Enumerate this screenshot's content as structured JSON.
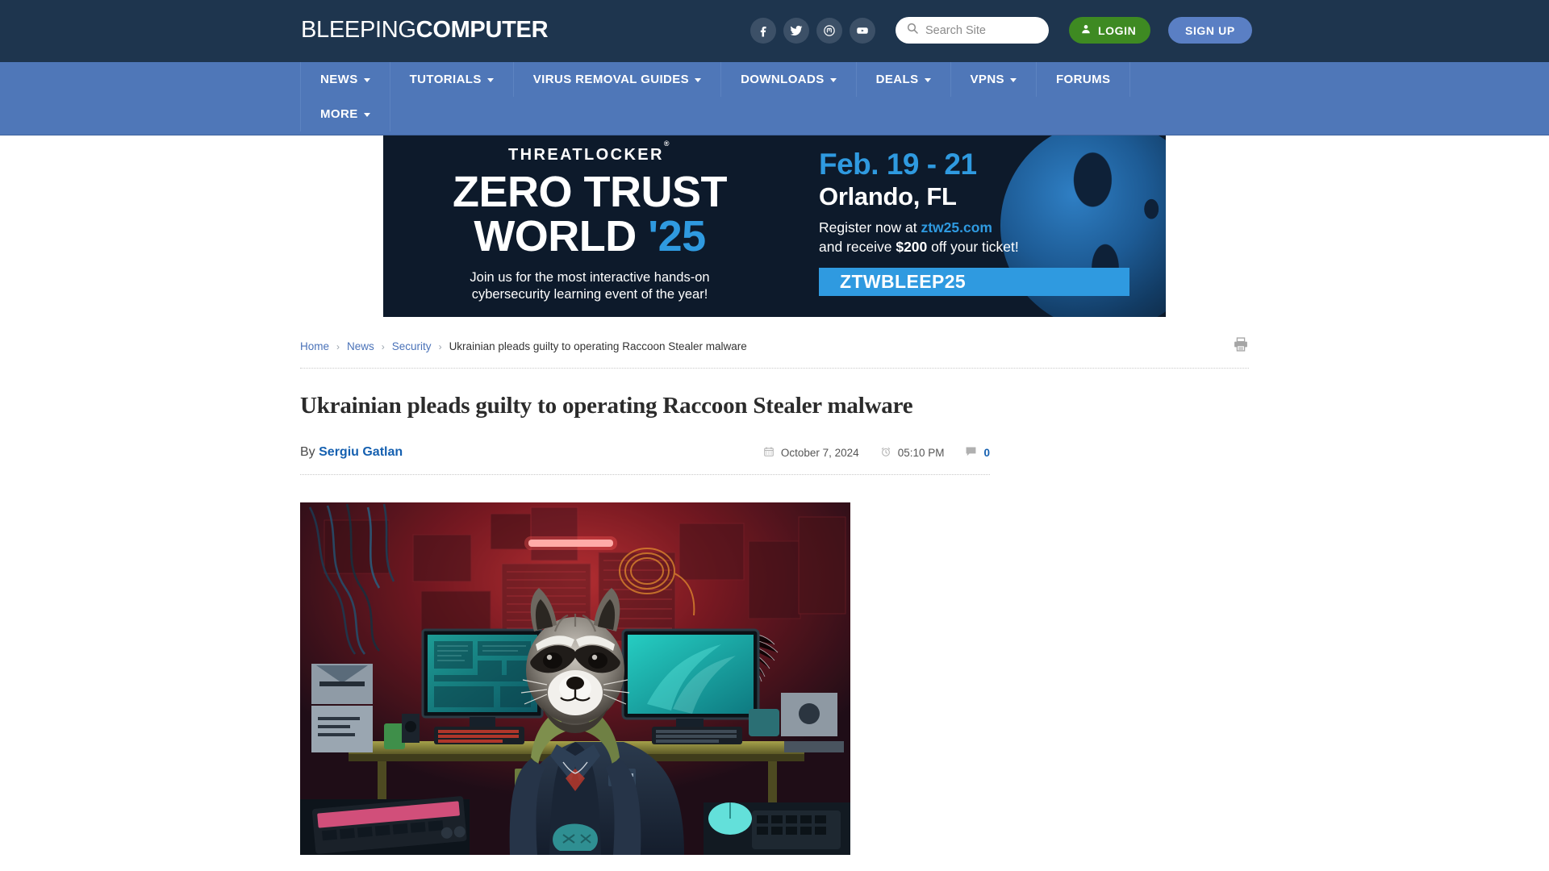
{
  "header": {
    "logo_light": "BLEEPING",
    "logo_bold": "COMPUTER",
    "social": [
      {
        "name": "facebook-icon",
        "label": "Facebook"
      },
      {
        "name": "twitter-icon",
        "label": "Twitter"
      },
      {
        "name": "mastodon-icon",
        "label": "Mastodon"
      },
      {
        "name": "youtube-icon",
        "label": "YouTube"
      }
    ],
    "search_placeholder": "Search Site",
    "search_value": "",
    "login_label": "LOGIN",
    "signup_label": "SIGN UP",
    "login_color": "#3e8a22",
    "signup_color": "#5a7fc4",
    "bar_color": "#1e354e"
  },
  "nav": {
    "bg_color": "#4f77b8",
    "items": [
      {
        "label": "NEWS",
        "caret": true
      },
      {
        "label": "TUTORIALS",
        "caret": true
      },
      {
        "label": "VIRUS REMOVAL GUIDES",
        "caret": true
      },
      {
        "label": "DOWNLOADS",
        "caret": true
      },
      {
        "label": "DEALS",
        "caret": true
      },
      {
        "label": "VPNS",
        "caret": true
      },
      {
        "label": "FORUMS",
        "caret": false
      },
      {
        "label": "MORE",
        "caret": true
      }
    ]
  },
  "ad": {
    "brand": "THREATLOCKER",
    "brand_mark": "®",
    "line1": "ZERO TRUST",
    "line2_main": "WORLD",
    "line2_year": "'25",
    "tagline_1": "Join us for the most interactive hands-on",
    "tagline_2": "cybersecurity learning event of the year!",
    "date": "Feb. 19 - 21",
    "city": "Orlando, FL",
    "register_prefix": "Register now at ",
    "register_link": "ztw25.com",
    "discount_prefix": "and receive ",
    "discount_amount": "$200",
    "discount_suffix": " off your ticket!",
    "promo_code": "ZTWBLEEP25",
    "accent_color": "#2f9ae0",
    "bg_color": "#0d1a2b"
  },
  "breadcrumb": {
    "items": [
      {
        "label": "Home",
        "link": true
      },
      {
        "label": "News",
        "link": true
      },
      {
        "label": "Security",
        "link": true
      },
      {
        "label": "Ukrainian pleads guilty to operating Raccoon Stealer malware",
        "link": false
      }
    ],
    "separator": "›",
    "print_icon": "printer-icon"
  },
  "article": {
    "title": "Ukrainian pleads guilty to operating Raccoon Stealer malware",
    "by_prefix": "By ",
    "author": "Sergiu Gatlan",
    "date": "October 7, 2024",
    "time": "05:10 PM",
    "comment_count": "0",
    "image_alt": "Raccoon hacker sitting at a neon-lit computer workstation"
  }
}
